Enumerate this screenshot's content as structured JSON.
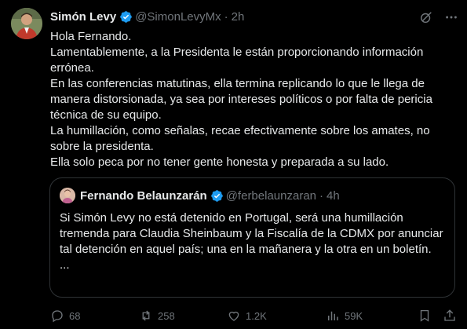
{
  "tweet": {
    "author_name": "Simón Levy",
    "handle": "@SimonLevyMx",
    "separator": "·",
    "time": "2h",
    "lines": [
      "Hola Fernando.",
      "Lamentablemente, a la Presidenta le están proporcionando información errónea.",
      "En las conferencias matutinas, ella termina replicando lo que le llega de manera distorsionada, ya sea por intereses políticos o por falta de pericia técnica de su equipo.",
      "La humillación, como señalas, recae efectivamente sobre los amates, no sobre la presidenta.",
      "Ella solo peca por no tener gente honesta y preparada a su lado."
    ]
  },
  "quoted": {
    "author_name": "Fernando Belaunzarán",
    "handle": "@ferbelaunzaran",
    "separator": "·",
    "time": "4h",
    "text": "Si Simón Levy no está detenido en Portugal, será una humillación tremenda para Claudia Sheinbaum y la Fiscalía de la CDMX por anunciar tal detención en aquel país; una en la mañanera y la otra en un boletín.",
    "more": "..."
  },
  "actions": {
    "replies": "68",
    "reposts": "258",
    "likes": "1.2K",
    "views": "59K"
  },
  "colors": {
    "background": "#000000",
    "text": "#e7e9ea",
    "muted": "#71767b",
    "verified": "#1d9bf0",
    "border": "#2f3336"
  }
}
